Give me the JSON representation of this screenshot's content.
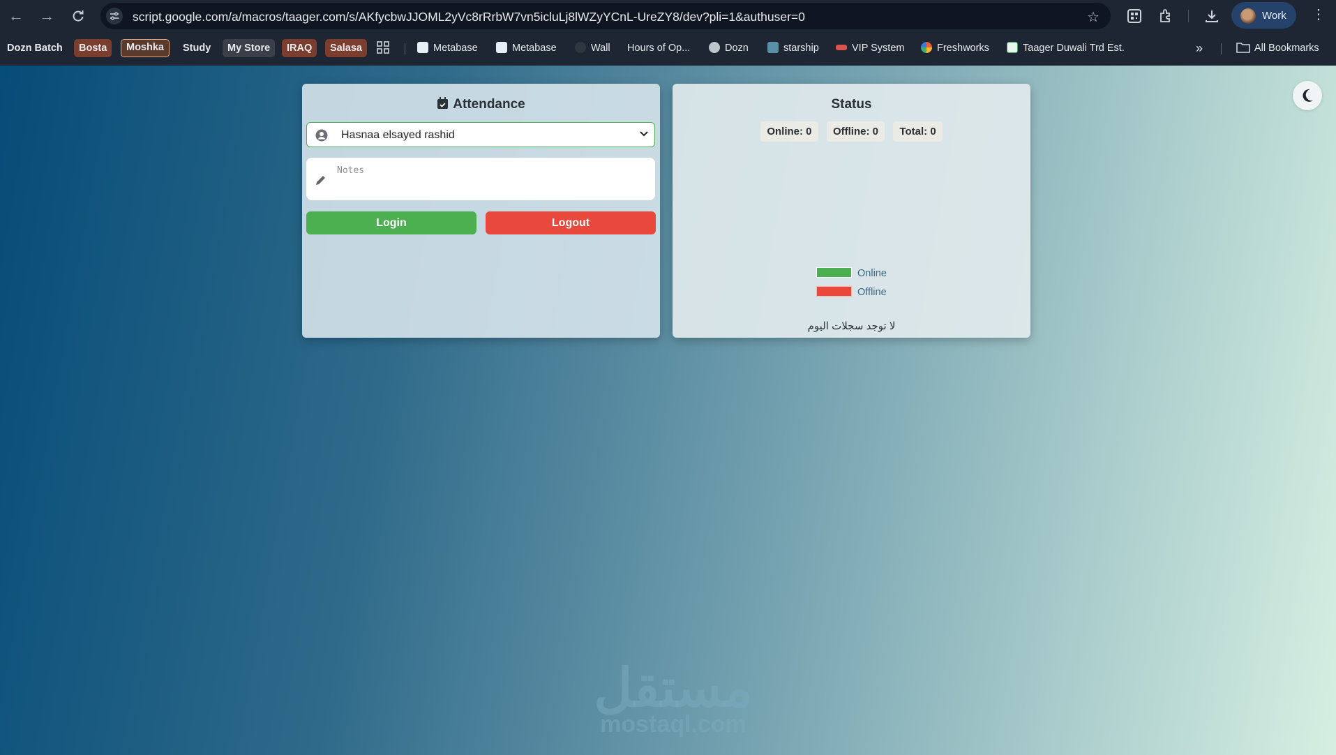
{
  "browser": {
    "url": "script.google.com/a/macros/taager.com/s/AKfycbwJJOML2yVc8rRrbW7vn5icluLj8lWZyYCnL-UreZY8/dev?pli=1&authuser=0",
    "profile_label": "Work"
  },
  "bookmarks": {
    "items": [
      {
        "label": "Dozn Batch"
      },
      {
        "label": "Bosta"
      },
      {
        "label": "Moshka"
      },
      {
        "label": "Study"
      },
      {
        "label": "My Store"
      },
      {
        "label": "IRAQ"
      },
      {
        "label": "Salasa"
      },
      {
        "label": "Metabase"
      },
      {
        "label": "Metabase"
      },
      {
        "label": "Wall"
      },
      {
        "label": "Hours of Op..."
      },
      {
        "label": "Dozn"
      },
      {
        "label": "starship"
      },
      {
        "label": "VIP System"
      },
      {
        "label": "Freshworks"
      },
      {
        "label": "Taager Duwali Trd Est."
      }
    ],
    "all_bookmarks_label": "All Bookmarks",
    "overflow_label": "»"
  },
  "attendance": {
    "title": "Attendance",
    "selected_user": "Hasnaa elsayed rashid",
    "notes_placeholder": "Notes",
    "login_label": "Login",
    "logout_label": "Logout"
  },
  "status": {
    "title": "Status",
    "online": "Online: 0",
    "offline": "Offline: 0",
    "total": "Total: 0",
    "legend_online": "Online",
    "legend_offline": "Offline",
    "no_records": "لا توجد سجلات اليوم",
    "colors": {
      "online": "#4caf50",
      "offline": "#e8493c"
    }
  },
  "watermark": {
    "arabic": "مستقل",
    "latin": "mostaql.com"
  }
}
